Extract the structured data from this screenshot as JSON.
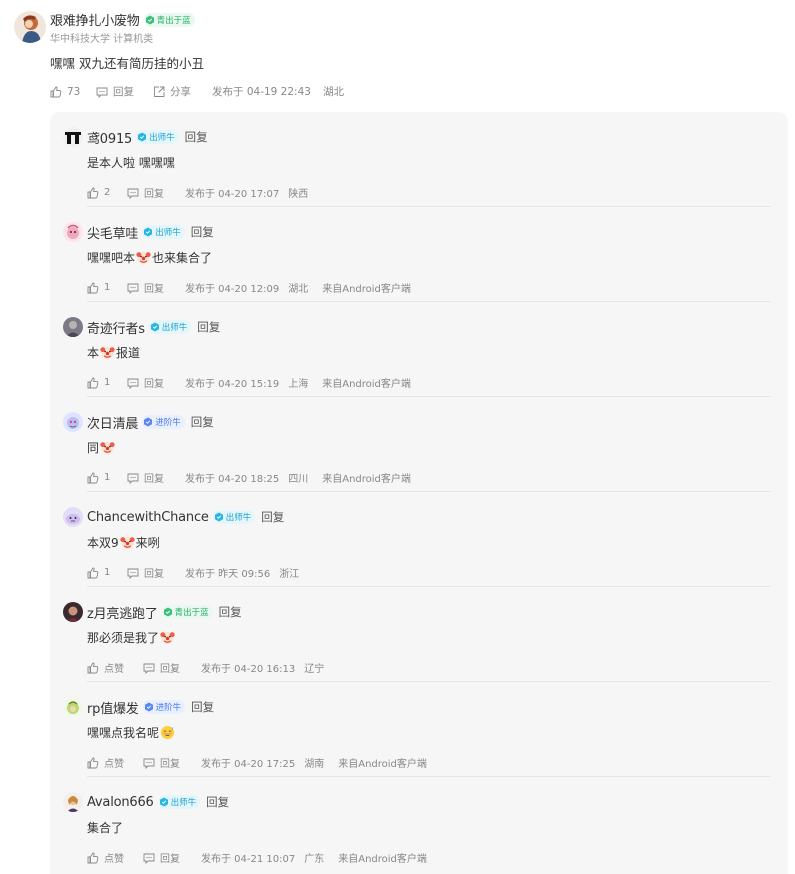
{
  "post": {
    "author": "艰难挣扎小废物",
    "badge": "青出于蓝",
    "school": "华中科技大学 计算机类",
    "text": "嘿嘿 双九还有简历挂的小丑",
    "likes": "73",
    "reply_label": "回复",
    "share_label": "分享",
    "time": "发布于 04-19 22:43",
    "location": "湖北"
  },
  "replies": [
    {
      "name": "鸢0915",
      "badge": "出师牛",
      "badge_color": "teal",
      "reply_label": "回复",
      "text_parts": [
        "是本人啦 嘿嘿嘿"
      ],
      "likes": "2",
      "action_reply": "回复",
      "time": "发布于 04-20 17:07",
      "location": "陕西",
      "source": ""
    },
    {
      "name": "尖毛草哇",
      "badge": "出师牛",
      "badge_color": "teal",
      "reply_label": "回复",
      "text_parts": [
        "嘿嘿吧本",
        "也来集合了"
      ],
      "likes": "1",
      "action_reply": "回复",
      "time": "发布于 04-20 12:09",
      "location": "湖北",
      "source": "来自Android客户端"
    },
    {
      "name": "奇迹行者s",
      "badge": "出师牛",
      "badge_color": "teal",
      "reply_label": "回复",
      "text_parts": [
        "本",
        "报道"
      ],
      "likes": "1",
      "action_reply": "回复",
      "time": "发布于 04-20 15:19",
      "location": "上海",
      "source": "来自Android客户端"
    },
    {
      "name": "次日清晨",
      "badge": "进阶牛",
      "badge_color": "blue",
      "reply_label": "回复",
      "text_parts": [
        "同"
      ],
      "likes": "1",
      "action_reply": "回复",
      "time": "发布于 04-20 18:25",
      "location": "四川",
      "source": "来自Android客户端"
    },
    {
      "name": "ChancewithChance",
      "badge": "出师牛",
      "badge_color": "teal",
      "reply_label": "回复",
      "text_parts": [
        "本双9",
        "来咧"
      ],
      "likes": "1",
      "action_reply": "回复",
      "time": "发布于 昨天 09:56",
      "location": "浙江",
      "source": ""
    },
    {
      "name": "z月亮逃跑了",
      "badge": "青出于蓝",
      "badge_color": "green",
      "reply_label": "回复",
      "text_parts": [
        "那必须是我了"
      ],
      "likes": "点赞",
      "action_reply": "回复",
      "time": "发布于 04-20 16:13",
      "location": "辽宁",
      "source": ""
    },
    {
      "name": "rp值爆发",
      "badge": "进阶牛",
      "badge_color": "blue",
      "reply_label": "回复",
      "text_parts": [
        "嘿嘿点我名呢"
      ],
      "likes": "点赞",
      "action_reply": "回复",
      "time": "发布于 04-20 17:25",
      "location": "湖南",
      "source": "来自Android客户端"
    },
    {
      "name": "Avalon666",
      "badge": "出师牛",
      "badge_color": "teal",
      "reply_label": "回复",
      "text_parts": [
        "集合了"
      ],
      "likes": "点赞",
      "action_reply": "回复",
      "time": "发布于 04-21 10:07",
      "location": "广东",
      "source": "来自Android客户端"
    }
  ],
  "icons": {
    "like": "thumbs-up-icon",
    "reply": "comment-icon",
    "share": "share-icon",
    "badge": "hexagon-badge-icon",
    "clown": "clown-face-emoji",
    "grin": "grinning-sweat-emoji"
  },
  "colors": {
    "badge_green": "#23b266",
    "badge_teal": "#1aa3d1",
    "badge_blue": "#4a78f0",
    "reply_bg": "#f6f6f7"
  }
}
